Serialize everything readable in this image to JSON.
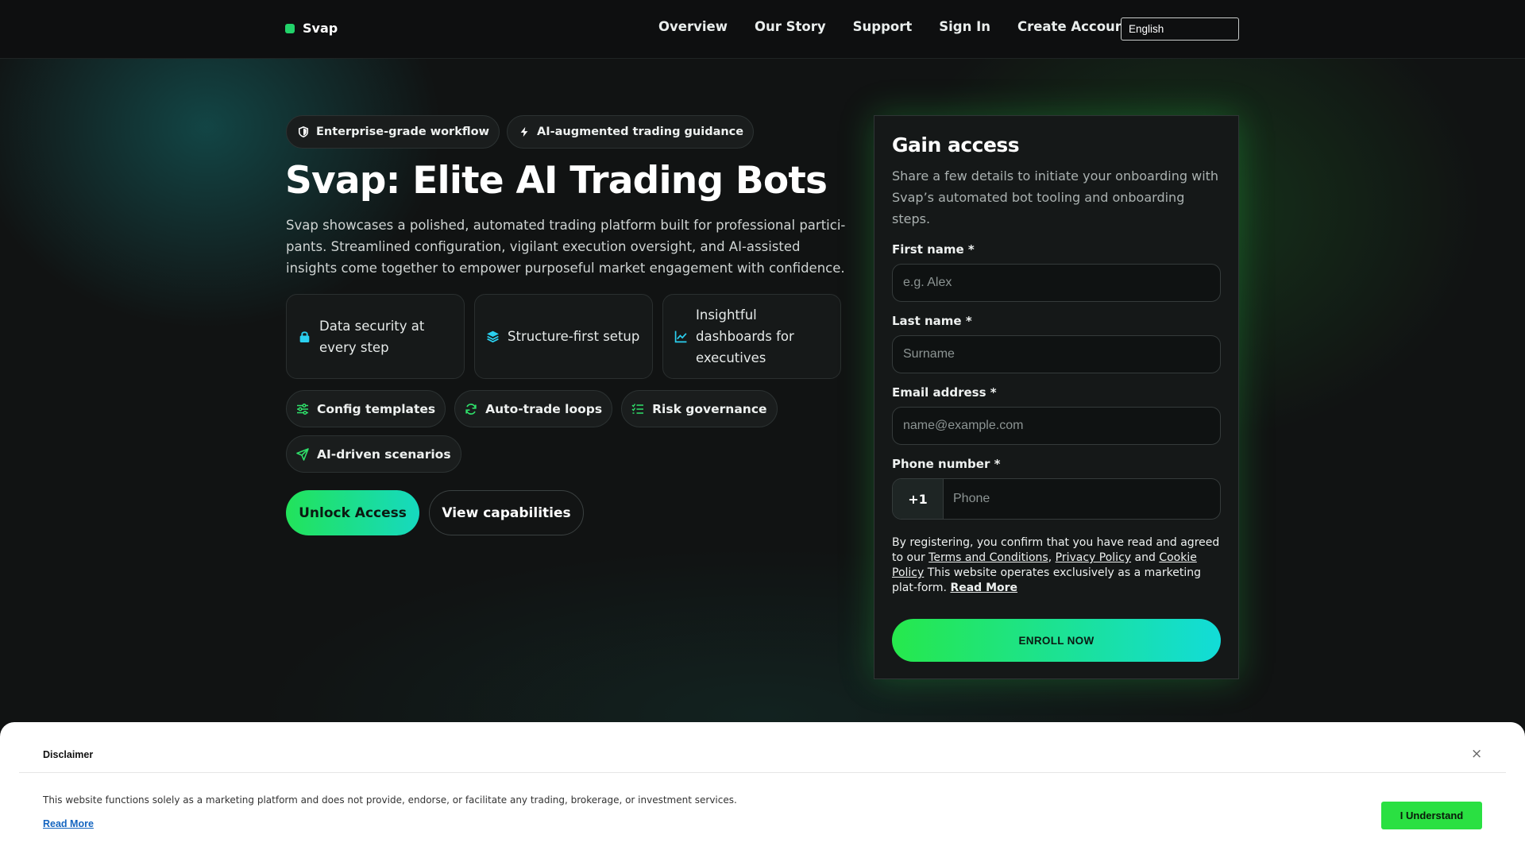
{
  "nav": {
    "logo_text": "Svap",
    "links": [
      "Overview",
      "Our Story",
      "Support",
      "Sign In",
      "Create Account"
    ],
    "language": "English"
  },
  "hero": {
    "badges": [
      {
        "icon": "shield-icon",
        "label": "Enterprise-grade workflow"
      },
      {
        "icon": "bolt-icon",
        "label": "AI-augmented trading guidance"
      }
    ],
    "title": "Svap: Elite AI Trading Bots",
    "description": "Svap showcases a polished, automated trading platform built for professional partici-pants. Streamlined configuration, vigilant execution oversight, and AI-assisted insights come together to empower purposeful market engagement with confidence.",
    "features": [
      {
        "icon": "lock-icon",
        "label": "Data security at every step"
      },
      {
        "icon": "layers-icon",
        "label": "Structure-first setup"
      },
      {
        "icon": "chart-line-icon",
        "label": "Insightful dashboards for executives"
      }
    ],
    "chips": [
      {
        "icon": "sliders-icon",
        "label": "Config templates"
      },
      {
        "icon": "refresh-icon",
        "label": "Auto-trade loops"
      },
      {
        "icon": "checklist-icon",
        "label": "Risk governance"
      },
      {
        "icon": "send-icon",
        "label": "AI-driven scenarios"
      }
    ],
    "primary_cta": "Unlock Access",
    "secondary_cta": "View capabilities"
  },
  "form": {
    "title": "Gain access",
    "subtitle": "Share a few details to initiate your onboarding with Svap’s automated bot tooling and onboarding steps.",
    "first_name_label": "First name *",
    "first_name_placeholder": "e.g. Alex",
    "last_name_label": "Last name *",
    "last_name_placeholder": "Surname",
    "email_label": "Email address *",
    "email_placeholder": "name@example.com",
    "phone_label": "Phone number *",
    "phone_code": "+1",
    "phone_placeholder": "Phone",
    "consent": {
      "prefix": "By registering, you confirm that you have read and agreed to our ",
      "terms": "Terms and Conditions",
      "comma": ", ",
      "privacy": "Privacy Policy",
      "and": " and ",
      "cookie": "Cookie Policy",
      "suffix": " This website operates exclusively as a marketing plat-form. ",
      "read_more": "Read More"
    },
    "submit": "ENROLL NOW"
  },
  "disclaimer": {
    "title": "Disclaimer",
    "close": "×",
    "text": "This website functions solely as a marketing platform and does not provide, endorse, or facilitate any trading, brokerage, or investment services.",
    "read_more": "Read More",
    "button": "I Understand"
  },
  "colors": {
    "accent_green": "#22e35a",
    "accent_cyan": "#16d9c0",
    "background": "#111313",
    "link_blue": "#1565c0"
  }
}
